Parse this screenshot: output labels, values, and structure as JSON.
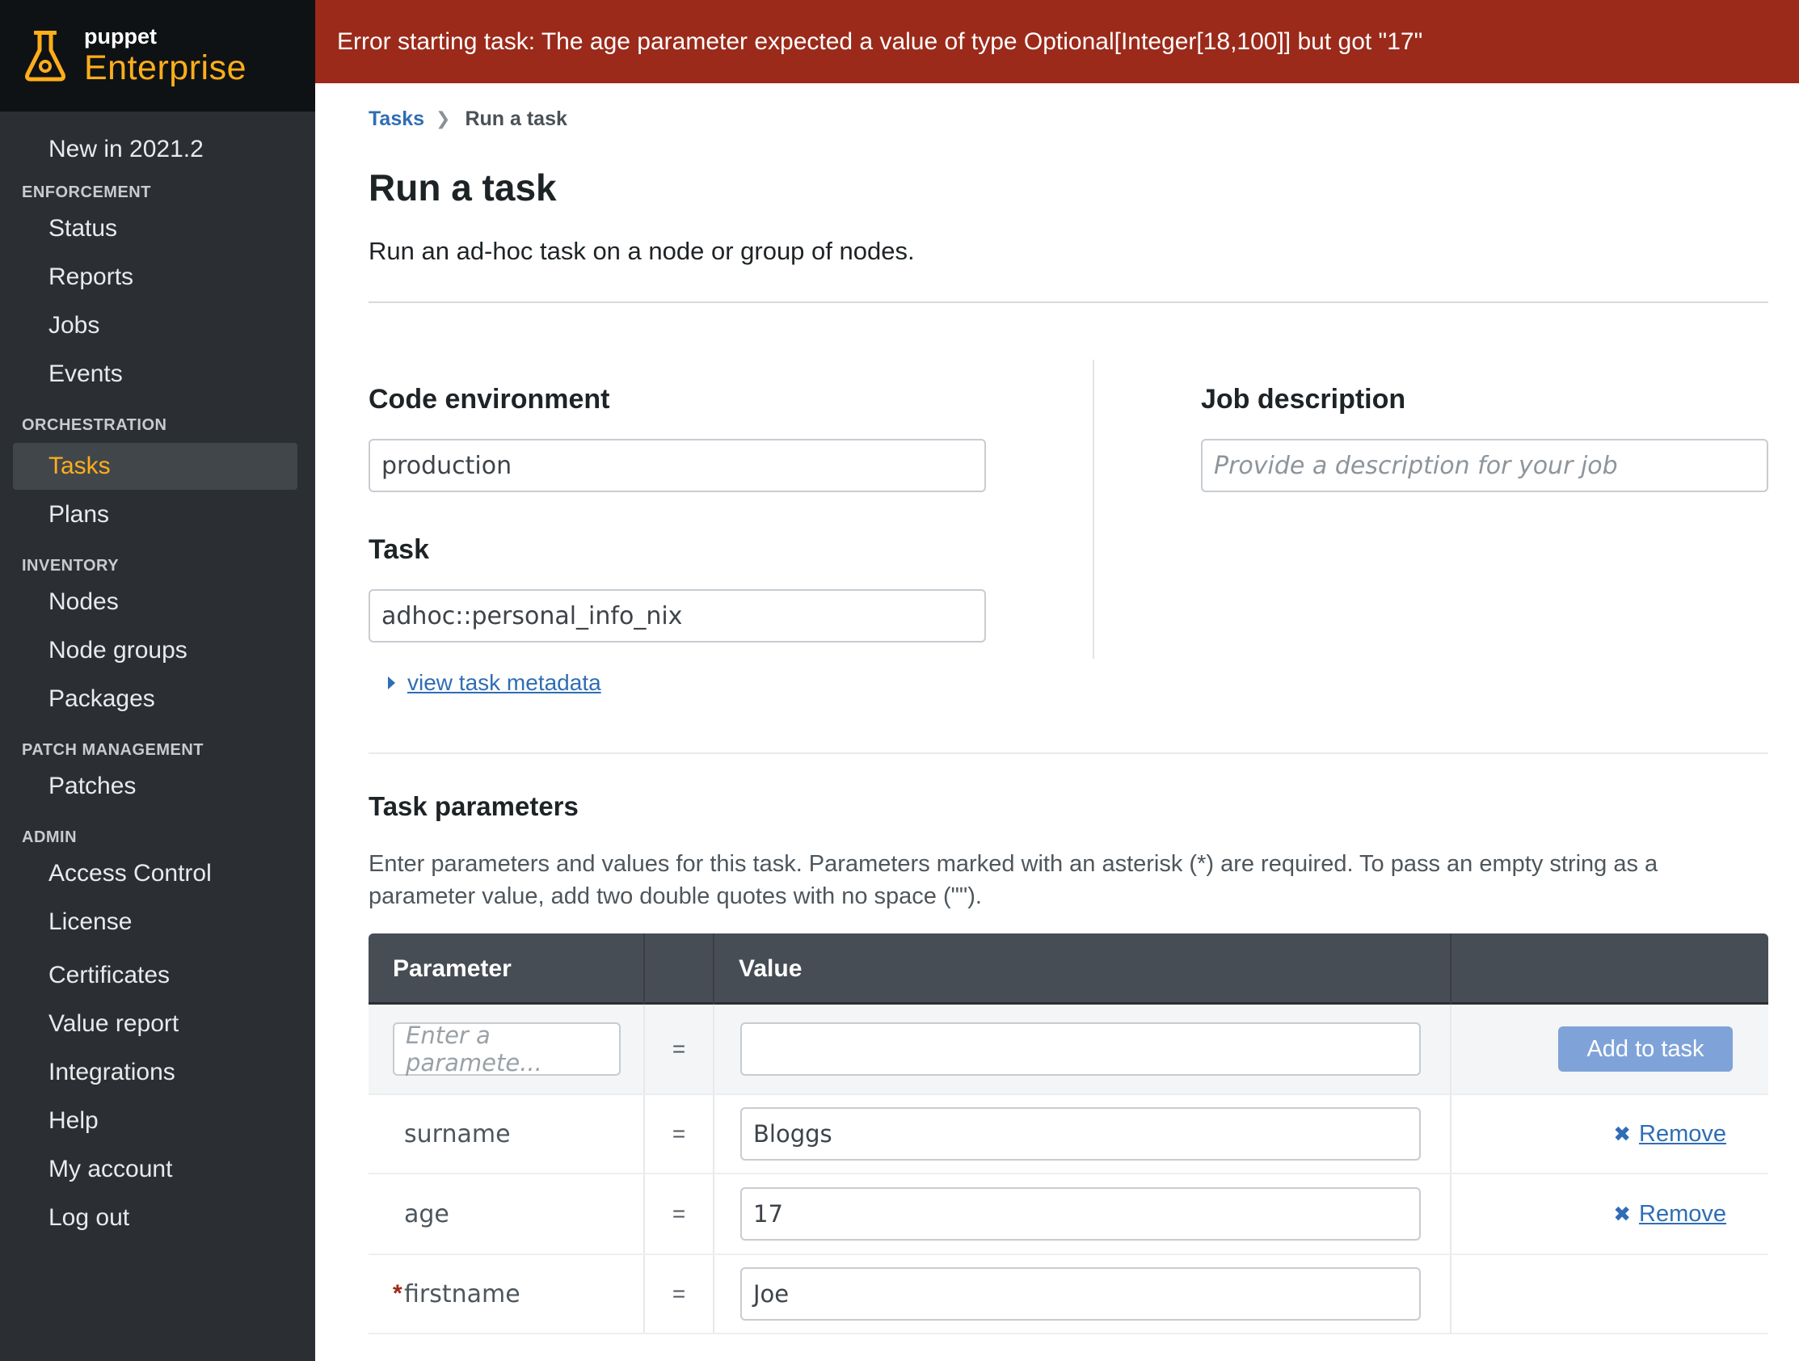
{
  "brand": {
    "small": "puppet",
    "big": "Enterprise"
  },
  "error": {
    "message": "Error starting task: The age parameter expected a value of type Optional[Integer[18,100]] but got \"17\""
  },
  "sidebar": {
    "whats_new": "New in 2021.2",
    "sections": {
      "enforcement": "ENFORCEMENT",
      "orchestration": "ORCHESTRATION",
      "inventory": "INVENTORY",
      "patch": "PATCH MANAGEMENT",
      "admin": "ADMIN"
    },
    "items": {
      "status": "Status",
      "reports": "Reports",
      "jobs": "Jobs",
      "events": "Events",
      "tasks": "Tasks",
      "plans": "Plans",
      "nodes": "Nodes",
      "node_groups": "Node groups",
      "packages": "Packages",
      "patches": "Patches",
      "access_control": "Access Control",
      "license": "License",
      "certificates": "Certificates",
      "value_report": "Value report",
      "integrations": "Integrations",
      "help": "Help",
      "my_account": "My account",
      "log_out": "Log out"
    },
    "active": "Tasks"
  },
  "breadcrumb": {
    "parent": "Tasks",
    "current": "Run a task"
  },
  "page": {
    "title": "Run a task",
    "subtitle": "Run an ad-hoc task on a node or group of nodes."
  },
  "form": {
    "code_env_label": "Code environment",
    "code_env_value": "production",
    "task_label": "Task",
    "task_value": "adhoc::personal_info_nix",
    "metadata_link": "view task metadata",
    "job_desc_label": "Job description",
    "job_desc_placeholder": "Provide a description for your job"
  },
  "params": {
    "heading": "Task parameters",
    "description": "Enter parameters and values for this task. Parameters marked with an asterisk (*) are required. To pass an empty string as a parameter value, add two double quotes with no space (\"\").",
    "headers": {
      "parameter": "Parameter",
      "value": "Value"
    },
    "new_param_placeholder": "Enter a paramete...",
    "new_value": "",
    "equals": "=",
    "add_button": "Add to task",
    "remove_label": "Remove",
    "rows": [
      {
        "name": "surname",
        "value": "Bloggs",
        "required": false
      },
      {
        "name": "age",
        "value": "17",
        "required": false
      },
      {
        "name": "firstname",
        "value": "Joe",
        "required": true,
        "marker": "*"
      }
    ]
  },
  "colors": {
    "sidebar_bg": "#2b2f33",
    "brand_bg": "#0f1214",
    "accent": "#ffae1a",
    "error_bg": "#9b2a1a",
    "link": "#2f6db5",
    "table_header": "#474d54",
    "add_button": "#7fa3d9"
  }
}
